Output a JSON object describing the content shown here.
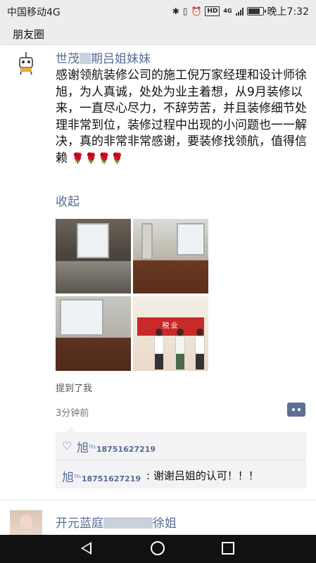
{
  "statusbar": {
    "carrier": "中国移动4G",
    "network": "4G",
    "hd": "HD",
    "battery_level": 0.85,
    "time": "晚上7:32",
    "icons": [
      "bluetooth-icon",
      "vibrate-icon",
      "alarm-icon",
      "hd-icon",
      "signal-icon",
      "battery-icon"
    ]
  },
  "titlebar": {
    "title": "朋友圈"
  },
  "post": {
    "user_prefix": "世茂",
    "user_suffix": "期吕姐妹妹",
    "text": "感谢领航装修公司的施工倪万家经理和设计师徐旭，为人真诚，处处为业主着想，从9月装修以来，一直尽心尽力，不辞劳苦，并且装修细节处理非常到位，装修过程中出现的小问题也一一解决，真的非常非常感谢，要装修找领航，值得信赖",
    "emoji": "🌹🌹🌹🌹",
    "collapse_label": "收起",
    "mention": "提到了我",
    "time": "3分钟前",
    "photo4_banner": "税业",
    "likes": {
      "name": "旭",
      "tel_label": "TEL",
      "tel": "18751627219"
    },
    "comment": {
      "name": "旭",
      "tel_label": "TEL",
      "tel": "18751627219",
      "text": ": 谢谢吕姐的认可！！！"
    }
  },
  "next_post": {
    "user_prefix": "开元蓝庭",
    "user_suffix": "徐姐"
  },
  "navbar": {
    "icons": [
      "back-icon",
      "home-icon",
      "recent-apps-icon"
    ]
  },
  "colors": {
    "link": "#576b95",
    "background": "#ededed",
    "comment_bg": "#f3f3f5"
  }
}
